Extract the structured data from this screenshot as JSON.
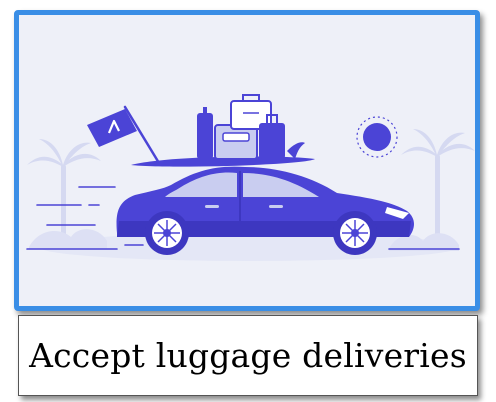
{
  "caption": {
    "text": "Accept luggage deliveries"
  },
  "illustration": {
    "icon": "car-luggage-beach-illustration",
    "colors": {
      "primary": "#4b44d6",
      "light": "#c9cdf0",
      "background": "#eef0f8",
      "frame": "#3a8ee6"
    }
  }
}
